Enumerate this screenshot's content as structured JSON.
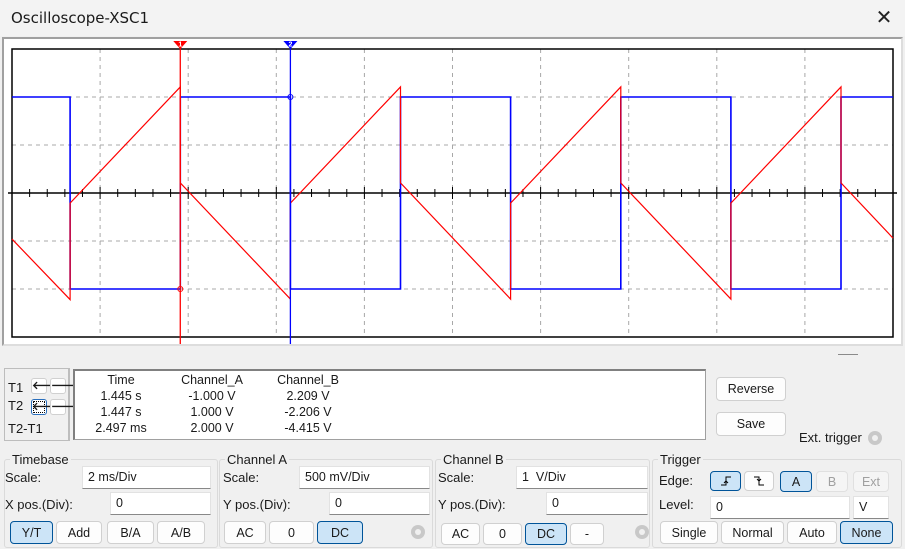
{
  "window": {
    "title": "Oscilloscope-XSC1",
    "close_icon": "close-icon"
  },
  "cursors": {
    "t1_label": "T1",
    "t2_label": "T2",
    "diff_label": "T2-T1",
    "t1_marker": "1",
    "t2_marker": "2",
    "t1_color": "#ff0000",
    "t2_color": "#0000ff"
  },
  "readout": {
    "headers": [
      "Time",
      "Channel_A",
      "Channel_B"
    ],
    "rows": [
      [
        "1.445 s",
        "-1.000 V",
        "2.209 V"
      ],
      [
        "1.447 s",
        "1.000 V",
        "-2.206 V"
      ],
      [
        "2.497 ms",
        "2.000 V",
        "-4.415 V"
      ]
    ]
  },
  "buttons": {
    "reverse": "Reverse",
    "save": "Save",
    "ext_trigger": "Ext. trigger"
  },
  "timebase": {
    "title": "Timebase",
    "scale_label": "Scale:",
    "scale": "2 ms/Div",
    "xpos_label": "X pos.(Div):",
    "xpos": "0",
    "modes": [
      "Y/T",
      "Add",
      "B/A",
      "A/B"
    ],
    "selected": "Y/T"
  },
  "channel_a": {
    "title": "Channel A",
    "scale_label": "Scale:",
    "scale": "500 mV/Div",
    "ypos_label": "Y pos.(Div):",
    "ypos": "0",
    "coupling": [
      "AC",
      "0",
      "DC"
    ],
    "selected": "DC"
  },
  "channel_b": {
    "title": "Channel B",
    "scale_label": "Scale:",
    "scale": "1  V/Div",
    "ypos_label": "Y pos.(Div):",
    "ypos": "0",
    "coupling": [
      "AC",
      "0",
      "DC",
      "-"
    ],
    "selected": "DC"
  },
  "trigger": {
    "title": "Trigger",
    "edge_label": "Edge:",
    "edges": [
      "rising-edge",
      "falling-edge"
    ],
    "edge_selected": "rising-edge",
    "sources": [
      "A",
      "B",
      "Ext"
    ],
    "source_selected": "A",
    "level_label": "Level:",
    "level": "0",
    "level_unit": "V",
    "modes": [
      "Single",
      "Normal",
      "Auto",
      "None"
    ],
    "mode_selected": "None"
  },
  "chart_data": {
    "type": "line",
    "x_unit": "ms",
    "xlim": [
      0,
      20
    ],
    "x_divisions": 10,
    "y_divisions": 6,
    "grid": true,
    "series": [
      {
        "channel": "A",
        "color": "#0000ff",
        "volts_per_div": 0.5,
        "points": [
          [
            0,
            1
          ],
          [
            1.32,
            1
          ],
          [
            1.32,
            -1
          ],
          [
            3.82,
            -1
          ],
          [
            3.82,
            1
          ],
          [
            6.32,
            1
          ],
          [
            6.32,
            -1
          ],
          [
            8.82,
            -1
          ],
          [
            8.82,
            1
          ],
          [
            11.32,
            1
          ],
          [
            11.32,
            -1
          ],
          [
            13.82,
            -1
          ],
          [
            13.82,
            1
          ],
          [
            16.32,
            1
          ],
          [
            16.32,
            -1
          ],
          [
            18.82,
            -1
          ],
          [
            18.82,
            1
          ],
          [
            20,
            1
          ]
        ]
      },
      {
        "channel": "B",
        "color": "#ff0000",
        "volts_per_div": 1,
        "points": [
          [
            0,
            -0.96
          ],
          [
            1.32,
            -2.22
          ],
          [
            1.32,
            -0.21
          ],
          [
            3.82,
            2.21
          ],
          [
            3.82,
            0.21
          ],
          [
            6.32,
            -2.21
          ],
          [
            6.32,
            -0.21
          ],
          [
            8.82,
            2.21
          ],
          [
            8.82,
            0.21
          ],
          [
            11.32,
            -2.21
          ],
          [
            11.32,
            -0.21
          ],
          [
            13.82,
            2.21
          ],
          [
            13.82,
            0.21
          ],
          [
            16.32,
            -2.21
          ],
          [
            16.32,
            -0.21
          ],
          [
            18.82,
            2.21
          ],
          [
            18.82,
            0.21
          ],
          [
            20,
            -0.94
          ]
        ]
      }
    ],
    "cursor_t1_ms": 3.82,
    "cursor_t2_ms": 6.32
  }
}
